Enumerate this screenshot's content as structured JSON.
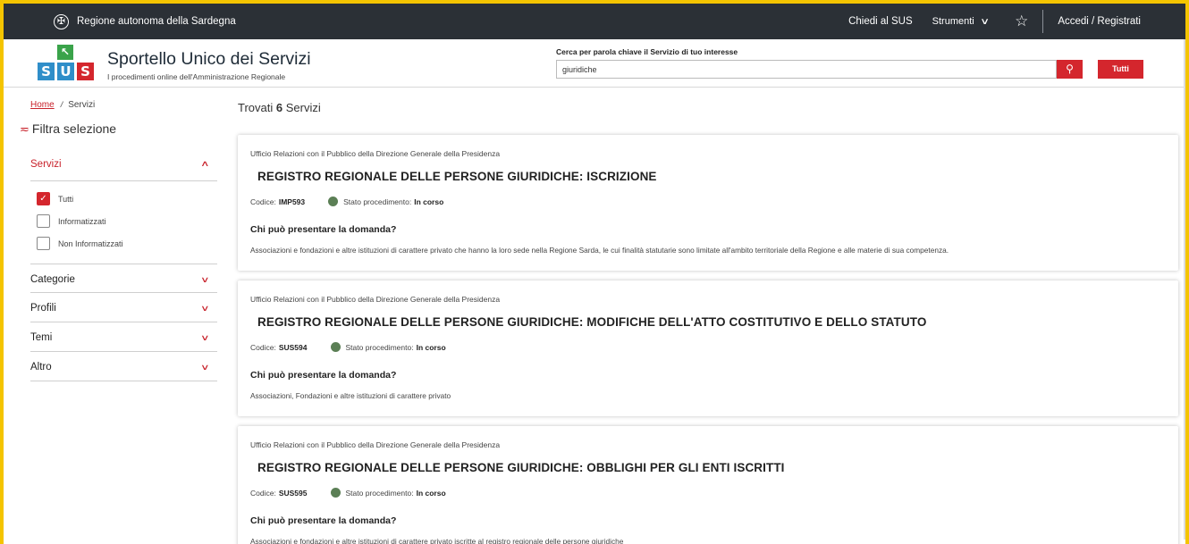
{
  "topbar": {
    "region": "Regione autonoma della Sardegna",
    "chiedi": "Chiedi al SUS",
    "strumenti": "Strumenti",
    "accedi": "Accedi / Registrati"
  },
  "header": {
    "logo_letters": [
      "S",
      "U",
      "S"
    ],
    "logo_colors": [
      "#2f8ec9",
      "#2f8ec9",
      "#d4262d"
    ],
    "title": "Sportello Unico dei Servizi",
    "subtitle": "I procedimenti online dell'Amministrazione Regionale",
    "search_label": "Cerca per parola chiave il Servizio di tuo interesse",
    "search_value": "giuridiche",
    "tutti_button": "Tutti"
  },
  "breadcrumb": {
    "home": "Home",
    "current": "Servizi"
  },
  "filter": {
    "title": "Filtra selezione",
    "servizi": "Servizi",
    "options": [
      {
        "label": "Tutti",
        "checked": true
      },
      {
        "label": "Informatizzati",
        "checked": false
      },
      {
        "label": "Non Informatizzati",
        "checked": false
      }
    ],
    "sections": [
      "Categorie",
      "Profili",
      "Temi",
      "Altro"
    ]
  },
  "results": {
    "prefix": "Trovati",
    "count": "6",
    "suffix": "Servizi",
    "code_label": "Codice:",
    "status_label": "Stato procedimento:",
    "question": "Chi può presentare la domanda?",
    "items": [
      {
        "office": "Ufficio Relazioni con il Pubblico della Direzione Generale della Presidenza",
        "title": "REGISTRO REGIONALE DELLE PERSONE GIURIDICHE: ISCRIZIONE",
        "code": "IMP593",
        "status": "In corso",
        "answer": "Associazioni e fondazioni e altre istituzioni di carattere privato che hanno la loro sede nella Regione Sarda, le cui finalità statutarie sono limitate all'ambito territoriale della Regione e alle materie di sua competenza."
      },
      {
        "office": "Ufficio Relazioni con il Pubblico della Direzione Generale della Presidenza",
        "title": "REGISTRO REGIONALE DELLE PERSONE GIURIDICHE: MODIFICHE DELL'ATTO COSTITUTIVO E DELLO STATUTO",
        "code": "SUS594",
        "status": "In corso",
        "answer": "Associazioni, Fondazioni e altre istituzioni di carattere privato"
      },
      {
        "office": "Ufficio Relazioni con il Pubblico della Direzione Generale della Presidenza",
        "title": "REGISTRO REGIONALE DELLE PERSONE GIURIDICHE: OBBLIGHI PER GLI ENTI ISCRITTI",
        "code": "SUS595",
        "status": "In corso",
        "answer": "Associazioni e fondazioni e altre istituzioni di carattere privato iscritte al registro regionale delle persone giuridiche"
      }
    ]
  },
  "colors": {
    "accent": "#d4262d",
    "topbar": "#2b3036",
    "status_dot": "#5b7f55",
    "frame": "#f4c400"
  }
}
